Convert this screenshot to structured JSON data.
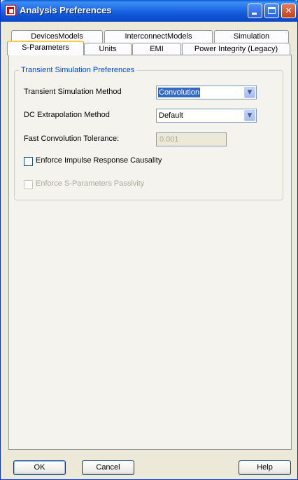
{
  "window": {
    "title": "Analysis Preferences"
  },
  "tabs": {
    "row_back": [
      "DevicesModels",
      "InterconnectModels",
      "Simulation"
    ],
    "row_front": [
      "S-Parameters",
      "Units",
      "EMI",
      "Power Integrity (Legacy)"
    ],
    "active": "S-Parameters"
  },
  "group": {
    "title": "Transient Simulation Preferences",
    "transient_method": {
      "label": "Transient Simulation Method",
      "value": "Convolution"
    },
    "dc_extrapolation": {
      "label": "DC Extrapolation Method",
      "value": "Default"
    },
    "tolerance": {
      "label": "Fast Convolution Tolerance:",
      "value": "0.001"
    },
    "causality": {
      "label": "Enforce Impulse Response Causality",
      "checked": false
    },
    "passivity": {
      "label": "Enforce S-Parameters Passivity",
      "checked": false,
      "enabled": false
    }
  },
  "buttons": {
    "ok": "OK",
    "cancel": "Cancel",
    "help": "Help"
  },
  "colors": {
    "titlebar": "#0a5ad6",
    "group_title": "#0046d5",
    "active_tab_accent": "#ffc83c"
  }
}
